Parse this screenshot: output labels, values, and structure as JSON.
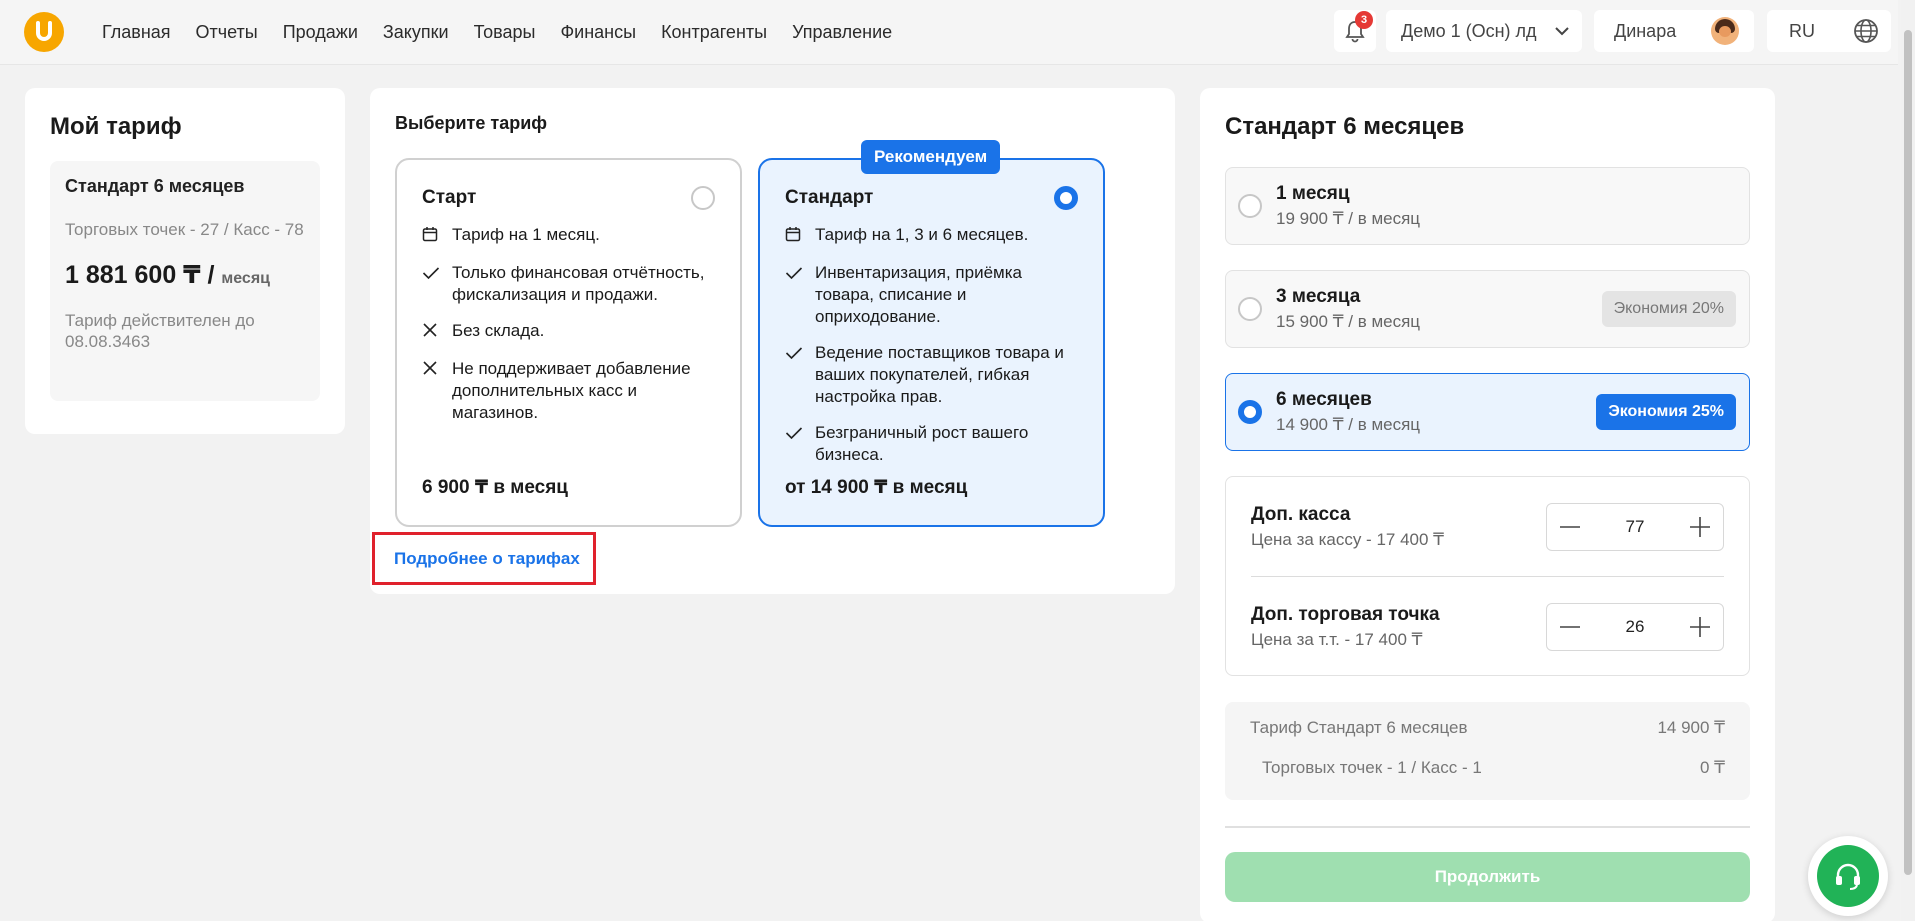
{
  "nav": {
    "items": [
      "Главная",
      "Отчеты",
      "Продажи",
      "Закупки",
      "Товары",
      "Финансы",
      "Контрагенты",
      "Управление"
    ],
    "notifications_count": "3",
    "company": "Демо 1 (Осн) лд",
    "user": "Динара",
    "lang": "RU"
  },
  "my_tariff": {
    "title": "Мой тариф",
    "name": "Стандарт 6 месяцев",
    "points": "Торговых точек - 27 / Касс - 78",
    "price": "1 881 600 ₸ /",
    "price_unit": "месяц",
    "valid": "Тариф действителен до 08.08.3463"
  },
  "choose": {
    "title": "Выберите тариф",
    "recommend_badge": "Рекомендуем",
    "more_link": "Подробнее о тарифах",
    "plans": [
      {
        "name": "Старт",
        "selected": false,
        "features": [
          {
            "icon": "calendar-icon",
            "text": "Тариф на 1 месяц."
          },
          {
            "icon": "check-icon",
            "text": "Только финансовая отчётность, фискализация и продажи."
          },
          {
            "icon": "cross-icon",
            "text": "Без склада."
          },
          {
            "icon": "cross-icon",
            "text": "Не поддерживает добавление дополнительных касс и магазинов."
          }
        ],
        "price": "6 900 ₸ в месяц"
      },
      {
        "name": "Стандарт",
        "selected": true,
        "features": [
          {
            "icon": "calendar-icon",
            "text": "Тариф на 1, 3 и 6 месяцев."
          },
          {
            "icon": "check-icon",
            "text": "Инвентаризация, приёмка товара, списание и оприходование."
          },
          {
            "icon": "check-icon",
            "text": "Ведение поставщиков товара и ваших покупателей, гибкая настройка прав."
          },
          {
            "icon": "check-icon",
            "text": "Безграничный рост вашего бизнеса."
          }
        ],
        "price": "от 14 900 ₸ в месяц"
      }
    ]
  },
  "summary": {
    "title": "Стандарт 6 месяцев",
    "periods": [
      {
        "label": "1 месяц",
        "price": "19 900 ₸ / в месяц",
        "saving": "",
        "selected": false
      },
      {
        "label": "3 месяца",
        "price": "15 900 ₸ / в месяц",
        "saving": "Экономия 20%",
        "selected": false
      },
      {
        "label": "6 месяцев",
        "price": "14 900 ₸ / в месяц",
        "saving": "Экономия 25%",
        "selected": true
      }
    ],
    "extras": [
      {
        "label": "Доп. касса",
        "price": "Цена за кассу - 17 400 ₸",
        "value": "77"
      },
      {
        "label": "Доп. торговая точка",
        "price": "Цена за т.т. - 17 400 ₸",
        "value": "26"
      }
    ],
    "totals": {
      "tariff_label": "Тариф Стандарт 6 месяцев",
      "tariff_value": "14 900 ₸",
      "sub_label": "Торговых точек - 1 / Касс - 1",
      "sub_value": "0 ₸"
    },
    "continue": "Продолжить"
  },
  "colors": {
    "accent": "#1a73e8",
    "logo": "#f7a600",
    "continue_disabled": "#9fdfb0",
    "support": "#21b357",
    "highlight_border": "#e0212c"
  }
}
